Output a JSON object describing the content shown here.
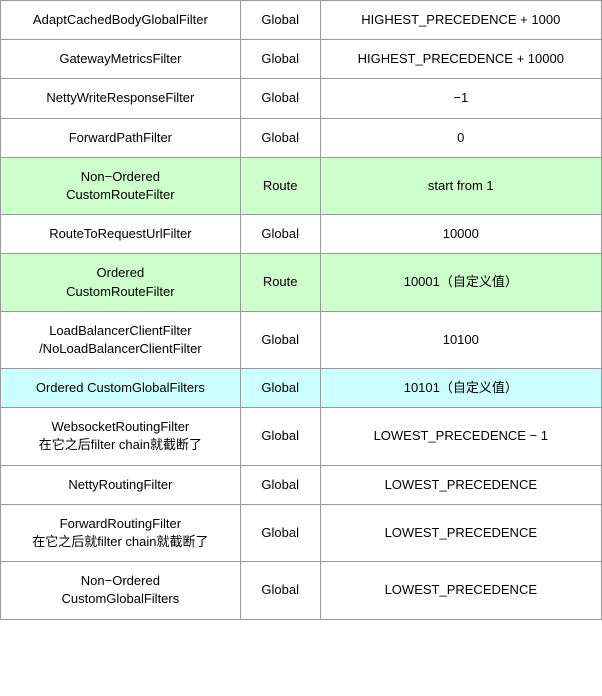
{
  "rows": [
    {
      "name": "AdaptCachedBodyGlobalFilter",
      "scope": "Global",
      "order": "HIGHEST_PRECEDENCE + 1000",
      "highlight": ""
    },
    {
      "name": "GatewayMetricsFilter",
      "scope": "Global",
      "order": "HIGHEST_PRECEDENCE + 10000",
      "highlight": ""
    },
    {
      "name": "NettyWriteResponseFilter",
      "scope": "Global",
      "order": "−1",
      "highlight": ""
    },
    {
      "name": "ForwardPathFilter",
      "scope": "Global",
      "order": "0",
      "highlight": ""
    },
    {
      "name": "Non−Ordered\nCustomRouteFilter",
      "scope": "Route",
      "order": "start from 1",
      "highlight": "green"
    },
    {
      "name": "RouteToRequestUrlFilter",
      "scope": "Global",
      "order": "10000",
      "highlight": ""
    },
    {
      "name": "Ordered\nCustomRouteFilter",
      "scope": "Route",
      "order": "10001（自定义值）",
      "highlight": "green"
    },
    {
      "name": "LoadBalancerClientFilter\n/NoLoadBalancerClientFilter",
      "scope": "Global",
      "order": "10100",
      "highlight": ""
    },
    {
      "name": "Ordered CustomGlobalFilters",
      "scope": "Global",
      "order": "10101（自定义值）",
      "highlight": "cyan"
    },
    {
      "name": "WebsocketRoutingFilter\n在它之后filter chain就截断了",
      "scope": "Global",
      "order": "LOWEST_PRECEDENCE − 1",
      "highlight": ""
    },
    {
      "name": "NettyRoutingFilter",
      "scope": "Global",
      "order": "LOWEST_PRECEDENCE",
      "highlight": ""
    },
    {
      "name": "ForwardRoutingFilter\n在它之后就filter chain就截断了",
      "scope": "Global",
      "order": "LOWEST_PRECEDENCE",
      "highlight": ""
    },
    {
      "name": "Non−Ordered\nCustomGlobalFilters",
      "scope": "Global",
      "order": "LOWEST_PRECEDENCE",
      "highlight": ""
    }
  ]
}
